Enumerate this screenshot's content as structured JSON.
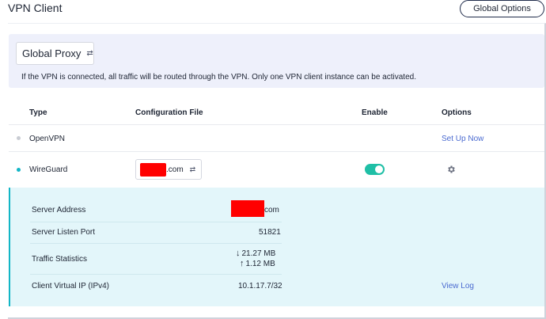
{
  "header": {
    "title": "VPN Client",
    "global_options_label": "Global Options"
  },
  "proxy": {
    "mode_value": "Global Proxy",
    "note": "If the VPN is connected, all traffic will be routed through the VPN. Only one VPN client instance can be activated."
  },
  "table": {
    "headers": {
      "type": "Type",
      "config": "Configuration File",
      "enable": "Enable",
      "options": "Options"
    },
    "rows": [
      {
        "type": "OpenVPN",
        "status_color": "#c9ccd3",
        "option_label": "Set Up Now"
      },
      {
        "type": "WireGuard",
        "status_color": "#13b6c6",
        "config_suffix": ".com",
        "enabled": true,
        "option_icon": "gear-icon"
      }
    ]
  },
  "details": {
    "server_address_label": "Server Address",
    "server_address_suffix": "com",
    "listen_port_label": "Server Listen Port",
    "listen_port_value": "51821",
    "traffic_label": "Traffic Statistics",
    "traffic_down": "21.27 MB",
    "traffic_up": "1.12 MB",
    "client_ip_label": "Client Virtual IP (IPv4)",
    "client_ip_value": "10.1.17.7/32",
    "view_log_label": "View Log"
  },
  "colors": {
    "accent": "#13b6c6",
    "toggle_on": "#1fbfa6",
    "link": "#4a6ad0",
    "redaction": "#ff0000"
  }
}
